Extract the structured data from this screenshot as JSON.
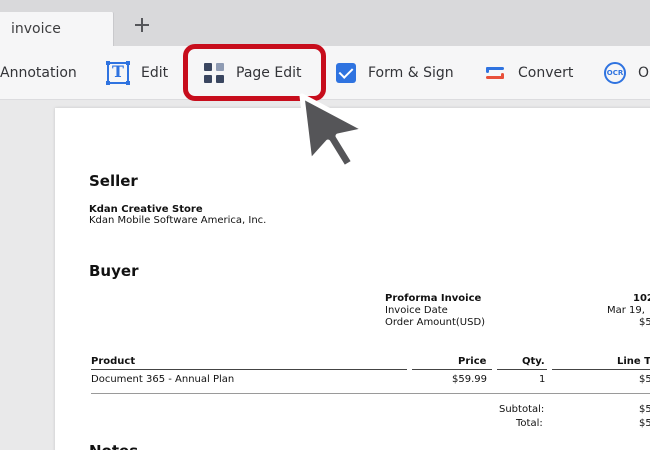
{
  "tabs": [
    {
      "label": "invoice"
    }
  ],
  "toolbar": {
    "annotation": "Annotation",
    "edit": "Edit",
    "page_edit": "Page Edit",
    "form_sign": "Form & Sign",
    "convert": "Convert",
    "ocr_icon_text": "OCR",
    "ocr_partial": "O"
  },
  "icons": {
    "new_tab": "plus-icon",
    "edit": "text-edit-icon",
    "page_edit": "grid-icon",
    "form_sign": "checkbox-icon",
    "convert": "convert-arrows-icon",
    "ocr": "ocr-icon",
    "cursor": "pointer-arrow-icon"
  },
  "colors": {
    "accent": "#2f73e0",
    "highlight": "#c70d1c",
    "grid_dark": "#3a4660",
    "grid_light": "#8f9bb3"
  },
  "document": {
    "seller_heading": "Seller",
    "seller_name": "Kdan Creative Store",
    "seller_company": "Kdan Mobile Software America, Inc.",
    "buyer_heading": "Buyer",
    "proforma_label": "Proforma Invoice",
    "invoice_date_label": "Invoice Date",
    "order_amount_label": "Order Amount(USD)",
    "proforma_value": "102",
    "invoice_date_value": "Mar 19,",
    "order_amount_value": "$5",
    "table": {
      "headers": {
        "product": "Product",
        "price": "Price",
        "qty": "Qty.",
        "line_total": "Line T"
      },
      "rows": [
        {
          "product": "Document 365 - Annual Plan",
          "price": "$59.99",
          "qty": "1",
          "line_total": "$5"
        }
      ]
    },
    "subtotal_label": "Subtotal:",
    "subtotal_value": "$5",
    "total_label": "Total:",
    "total_value": "$5",
    "notes_heading": "Notes"
  }
}
